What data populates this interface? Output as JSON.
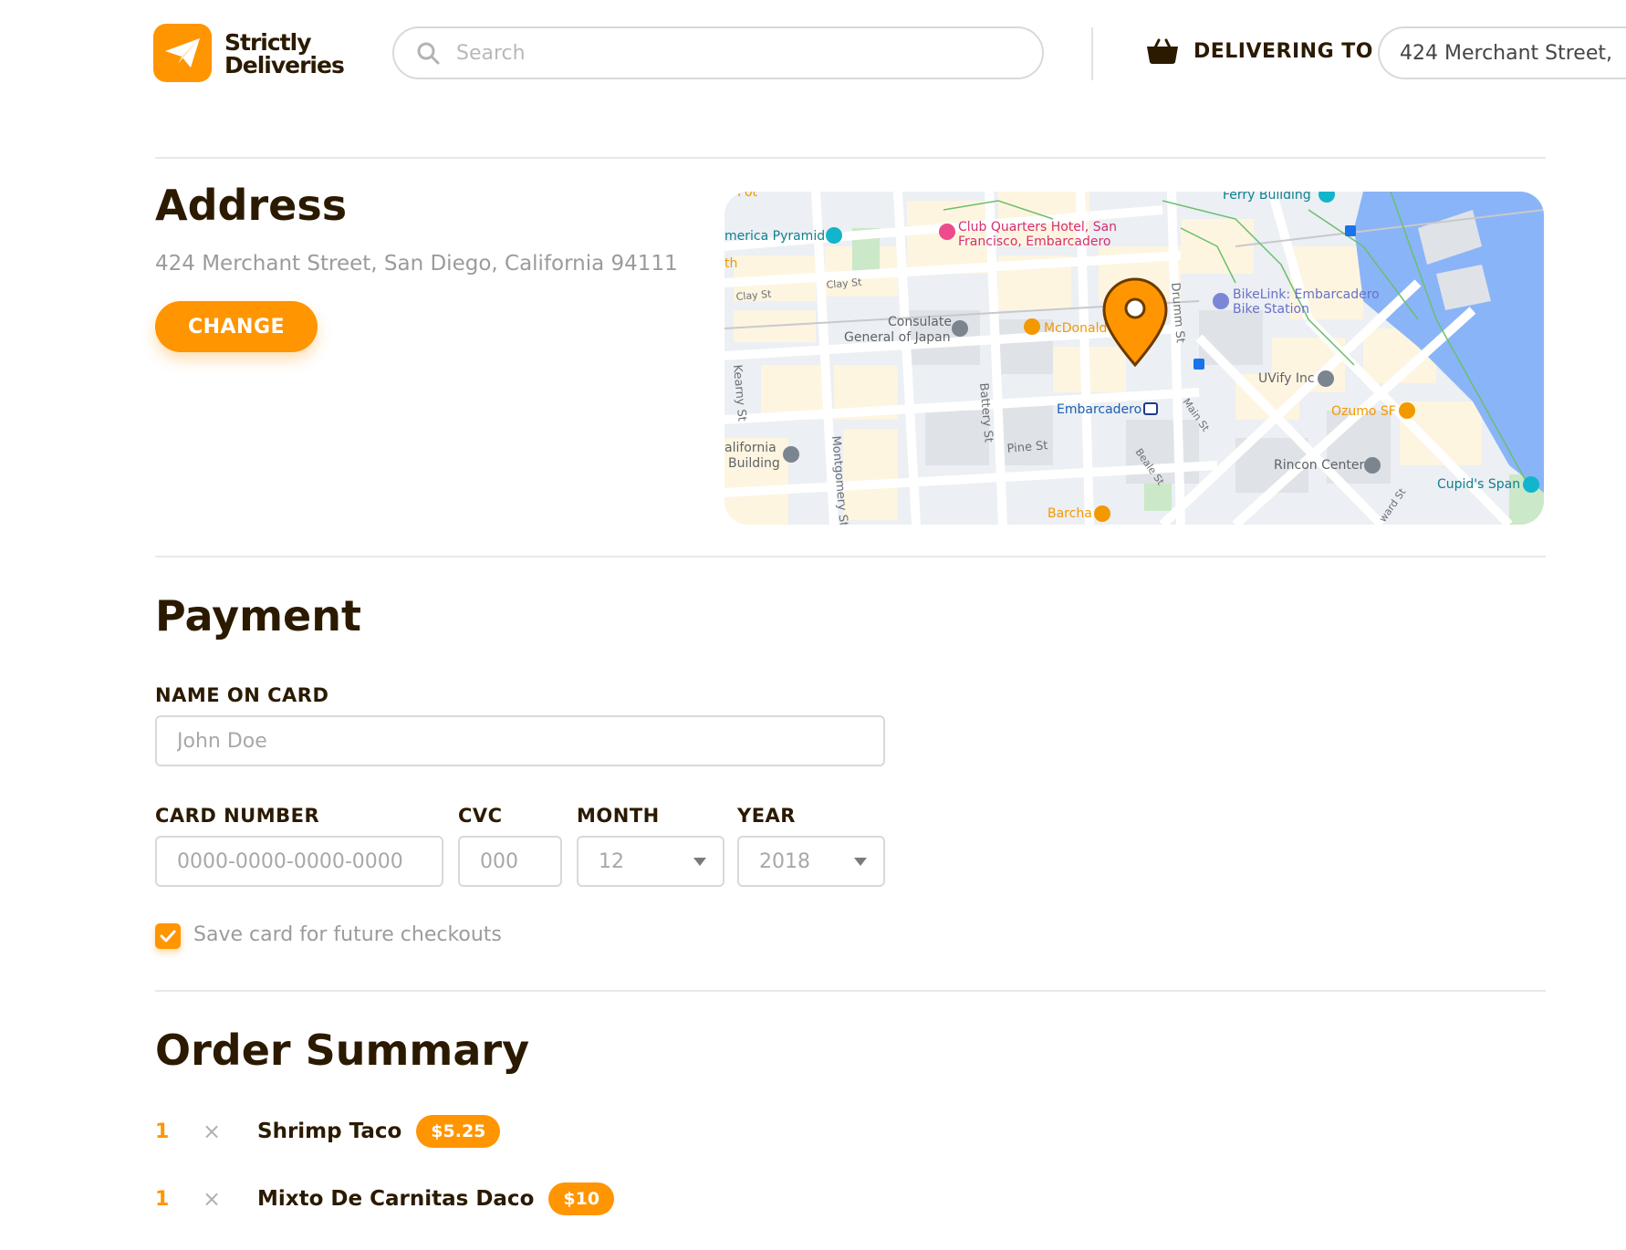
{
  "header": {
    "brand_line1": "Strictly",
    "brand_line2": "Deliveries",
    "search_placeholder": "Search",
    "delivering_label": "DELIVERING TO",
    "delivering_address": "424 Merchant Street,"
  },
  "address": {
    "title": "Address",
    "full_address": "424 Merchant Street, San Diego, California 94111",
    "change_label": "CHANGE",
    "map_labels": {
      "ferry": "Ferry Building",
      "pyramid": "merica Pyramid",
      "club1": "Club Quarters Hotel, San",
      "club2": "Francisco, Embarcadero",
      "consulate1": "Consulate",
      "consulate2": "General of Japan",
      "mcd": "McDonald",
      "bikelink1": "BikeLink: Embarcadero",
      "bikelink2": "Bike Station",
      "uvify": "UVify Inc",
      "ozumo": "Ozumo SF",
      "embarcadero": "Embarcadero",
      "california1": "alifornia",
      "california2": "Building",
      "rincon": "Rincon Center",
      "cupids": "Cupid's Span",
      "barcha": "Barcha",
      "clay1": "Clay St",
      "clay2": "Clay St",
      "kearny": "Kearny St",
      "montgomery": "Montgomery St",
      "battery": "Battery St",
      "pine": "Pine St",
      "drumm": "Drumm St",
      "main": "Main St",
      "beale": "Beale St",
      "howard": "ward St",
      "pot": "Pot",
      "th": "th"
    }
  },
  "payment": {
    "title": "Payment",
    "name_label": "NAME ON CARD",
    "name_placeholder": "John Doe",
    "card_label": "CARD NUMBER",
    "card_placeholder": "0000-0000-0000-0000",
    "cvc_label": "CVC",
    "cvc_placeholder": "000",
    "month_label": "MONTH",
    "month_value": "12",
    "year_label": "YEAR",
    "year_value": "2018",
    "save_card_label": "Save card for future checkouts"
  },
  "order": {
    "title": "Order Summary",
    "items": [
      {
        "qty": "1",
        "times": "×",
        "name": "Shrimp Taco",
        "price": "$5.25"
      },
      {
        "qty": "1",
        "times": "×",
        "name": "Mixto De Carnitas Daco",
        "price": "$10"
      }
    ]
  },
  "colors": {
    "accent": "#ff9500",
    "text": "#2b1a00",
    "muted": "#9b9b9b"
  }
}
